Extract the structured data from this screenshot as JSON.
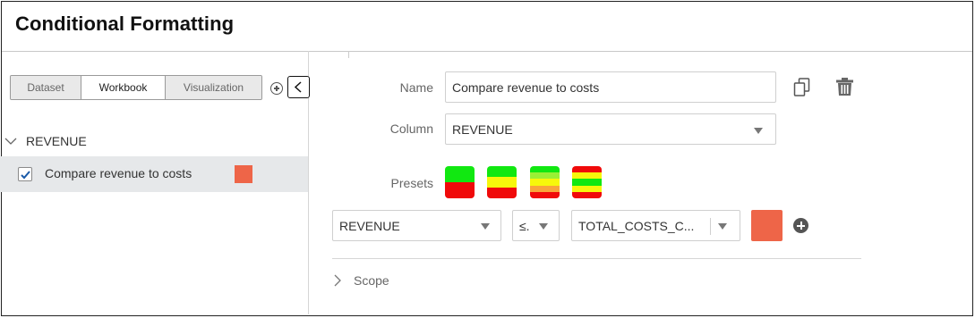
{
  "header": {
    "title": "Conditional Formatting"
  },
  "sidebar": {
    "tabs": [
      {
        "label": "Dataset",
        "active": false
      },
      {
        "label": "Workbook",
        "active": true
      },
      {
        "label": "Visualization",
        "active": false
      }
    ],
    "group": {
      "label": "REVENUE",
      "expanded": true
    },
    "rules": [
      {
        "label": "Compare revenue to costs",
        "checked": true,
        "color": "#ee6548"
      }
    ]
  },
  "form": {
    "name_label": "Name",
    "name_value": "Compare revenue to costs",
    "column_label": "Column",
    "column_value": "REVENUE",
    "presets_label": "Presets",
    "presets": [
      {
        "name": "green-red",
        "colors": [
          "#11e811",
          "#f00a0a"
        ]
      },
      {
        "name": "green-yellow-red",
        "colors": [
          "#11e811",
          "#f7f70b",
          "#f00a0a"
        ]
      },
      {
        "name": "green-lightgreen-yellow-orange-red",
        "colors": [
          "#11e811",
          "#9af035",
          "#f7f70b",
          "#f9a53a",
          "#f00a0a"
        ]
      },
      {
        "name": "red-yellow-green-yellow-red",
        "colors": [
          "#f00a0a",
          "#f7f70b",
          "#11e811",
          "#f7f70b",
          "#f00a0a"
        ]
      }
    ],
    "condition": {
      "column": "REVENUE",
      "operator": "≤.",
      "compare_to": "TOTAL_COSTS_C...",
      "color": "#ee6548"
    },
    "scope_label": "Scope"
  },
  "icons": {
    "add_rule": "plus-circle-icon",
    "collapse": "chevron-left-icon",
    "copy": "copy-icon",
    "delete": "trash-icon",
    "add_condition": "plus-circle-filled-icon",
    "expand_group": "chevron-down-icon",
    "scope": "chevron-right-icon"
  }
}
